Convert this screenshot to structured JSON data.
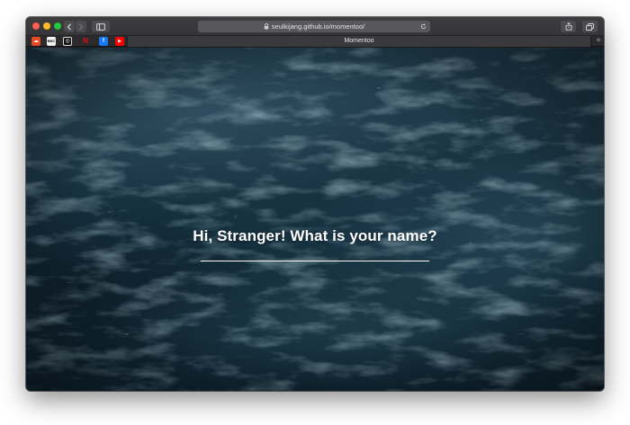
{
  "browser": {
    "url": "seulkijang.github.io/momentoo/",
    "tab_title": "Momentoo",
    "new_tab_label": "+"
  },
  "favorites": [
    {
      "name": "soundcloud",
      "glyph": "☁"
    },
    {
      "name": "bbc",
      "glyph": "BBC"
    },
    {
      "name": "circle-site",
      "glyph": "◎"
    },
    {
      "name": "netflix",
      "glyph": "N"
    },
    {
      "name": "facebook",
      "glyph": "f"
    },
    {
      "name": "youtube",
      "glyph": "▶"
    }
  ],
  "main": {
    "greeting": "Hi, Stranger! What is your name?",
    "name_value": "",
    "name_placeholder": ""
  },
  "colors": {
    "accent_text": "#ffffff",
    "ocean_deep": "#122b39"
  }
}
